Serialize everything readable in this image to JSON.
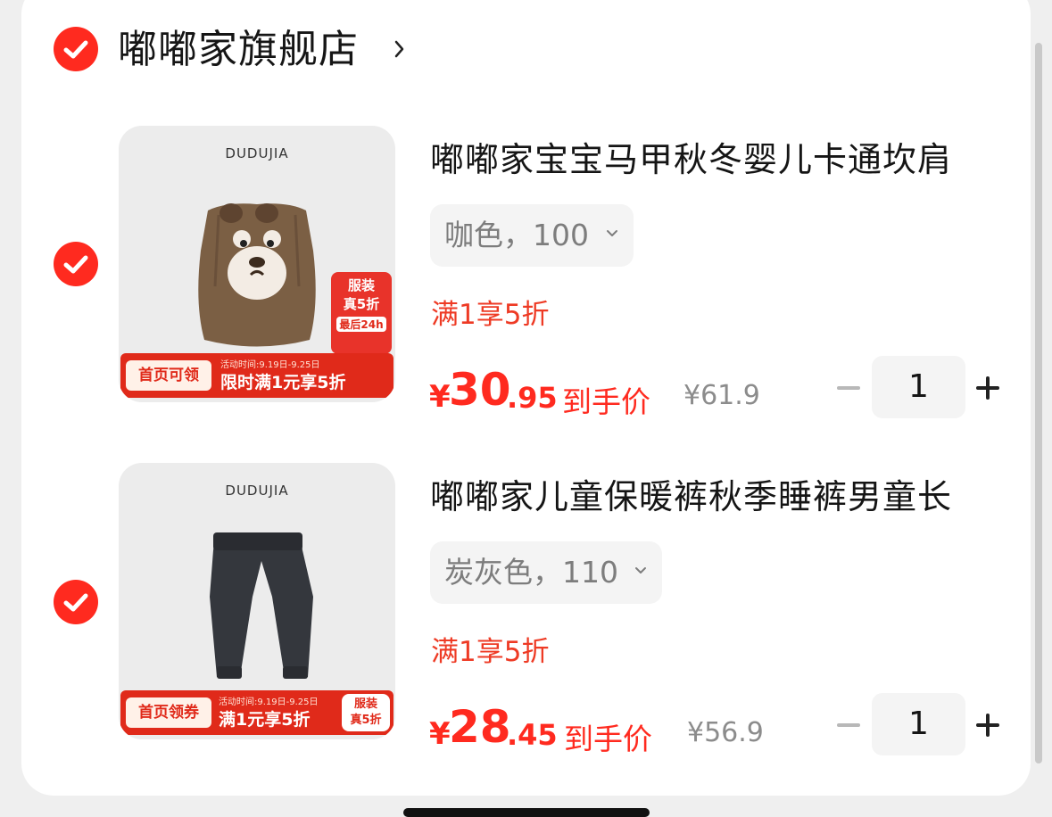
{
  "shop": {
    "name": "嘟嘟家旗舰店",
    "checked": true
  },
  "items": [
    {
      "checked": true,
      "image_brand": "DUDUJIA",
      "image_strip_left": "首页可领",
      "image_strip_date": "活动时间:9.19日-9.25日",
      "image_strip_main": "限时满1元享5折",
      "image_tag_line1": "服装",
      "image_tag_line2": "真5折",
      "image_tag_line3": "最后24h",
      "title": "嘟嘟家宝宝马甲秋冬婴儿卡通坎肩",
      "sku": "咖色，100",
      "promo": "满1享5折",
      "price_symbol": "¥",
      "price_int": "30",
      "price_dec": ".95",
      "price_label": "到手价",
      "original_price": "¥61.9",
      "quantity": "1"
    },
    {
      "checked": true,
      "image_brand": "DUDUJIA",
      "image_strip_left": "首页领券",
      "image_strip_date": "活动时间:9.19日-9.25日",
      "image_strip_main": "满1元享5折",
      "image_tag_line1": "服装",
      "image_tag_line2": "真5折",
      "title": "嘟嘟家儿童保暖裤秋季睡裤男童长",
      "sku": "炭灰色，110",
      "promo": "满1享5折",
      "price_symbol": "¥",
      "price_int": "28",
      "price_dec": ".45",
      "price_label": "到手价",
      "original_price": "¥56.9",
      "quantity": "1"
    }
  ],
  "colors": {
    "accent": "#ff2a1f",
    "promo": "#ee3a24",
    "muted": "#8c8c8c",
    "card": "#ffffff"
  }
}
